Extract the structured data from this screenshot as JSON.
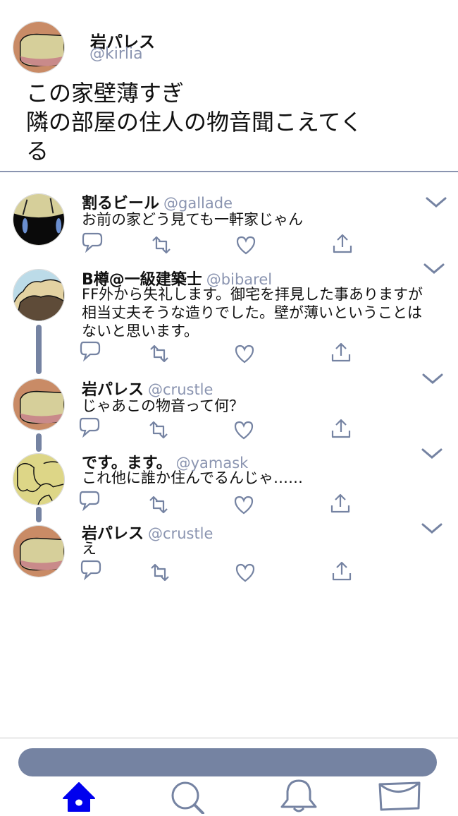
{
  "main_tweet": {
    "name": "岩パレス",
    "handle": "@kirlia",
    "text": "この家壁薄すぎ\n隣の部屋の住人の物音聞こえてく\nる"
  },
  "replies": [
    {
      "name": "割るビール",
      "handle": "@gallade",
      "text": "お前の家どう見ても一軒家じゃん",
      "avatar": "gallade-avatar"
    },
    {
      "name": "B樽@一級建築士",
      "handle": "@bibarel",
      "text": "FF外から失礼します。御宅を拝見した事ありますが相当丈夫そうな造りでした。壁が薄いということはないと思います。",
      "avatar": "bibarel-avatar"
    },
    {
      "name": "岩パレス",
      "handle": "@crustle",
      "text": "じゃあこの物音って何？",
      "avatar": "crustle-avatar"
    },
    {
      "name": "です。ます。",
      "handle": "@yamask",
      "text": "これ他に誰か住んでるんじゃ……",
      "avatar": "yamask-avatar"
    },
    {
      "name": "岩パレス",
      "handle": "@crustle",
      "text": "え",
      "avatar": "crustle-avatar"
    }
  ],
  "icons": {
    "reply": "speech-bubble-icon",
    "retweet": "retweet-icon",
    "like": "heart-icon",
    "share": "share-icon",
    "more": "chevron-down-icon",
    "tabs": [
      "home-icon",
      "search-icon",
      "bell-icon",
      "mail-icon"
    ]
  },
  "colors": {
    "accent": "#7583a2",
    "handle": "#8a94b0",
    "home_active": "#0000ee"
  }
}
